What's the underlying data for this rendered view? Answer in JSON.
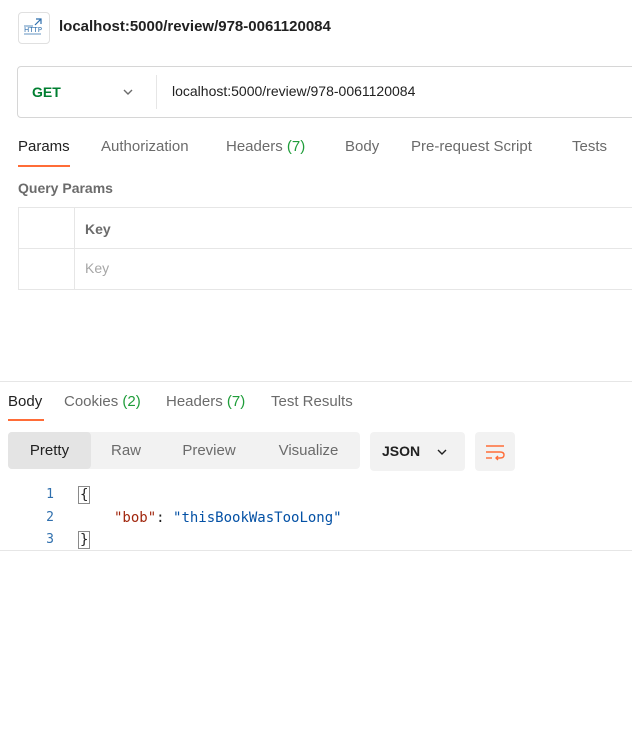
{
  "header": {
    "title": "localhost:5000/review/978-0061120084",
    "icon": "http-icon"
  },
  "request": {
    "method": "GET",
    "url": "localhost:5000/review/978-0061120084",
    "tabs": [
      {
        "label": "Params",
        "count": "",
        "active": true
      },
      {
        "label": "Authorization",
        "count": ""
      },
      {
        "label": "Headers",
        "count": "(7)"
      },
      {
        "label": "Body",
        "count": ""
      },
      {
        "label": "Pre-request Script",
        "count": ""
      },
      {
        "label": "Tests",
        "count": ""
      }
    ],
    "query_params_label": "Query Params",
    "table": {
      "key_header": "Key",
      "key_placeholder": "Key"
    }
  },
  "response": {
    "tabs": [
      {
        "label": "Body",
        "count": "",
        "active": true
      },
      {
        "label": "Cookies",
        "count": "(2)"
      },
      {
        "label": "Headers",
        "count": "(7)"
      },
      {
        "label": "Test Results",
        "count": ""
      }
    ],
    "view_modes": [
      "Pretty",
      "Raw",
      "Preview",
      "Visualize"
    ],
    "active_view": "Pretty",
    "format": "JSON",
    "code": {
      "line_numbers": [
        "1",
        "2",
        "3"
      ],
      "open": "{",
      "key": "\"bob\"",
      "colon": ": ",
      "value": "\"thisBookWasTooLong\"",
      "close": "}"
    }
  },
  "colors": {
    "accent": "#ff6c37",
    "get_method": "#007f31",
    "count": "#1f9d3a"
  }
}
